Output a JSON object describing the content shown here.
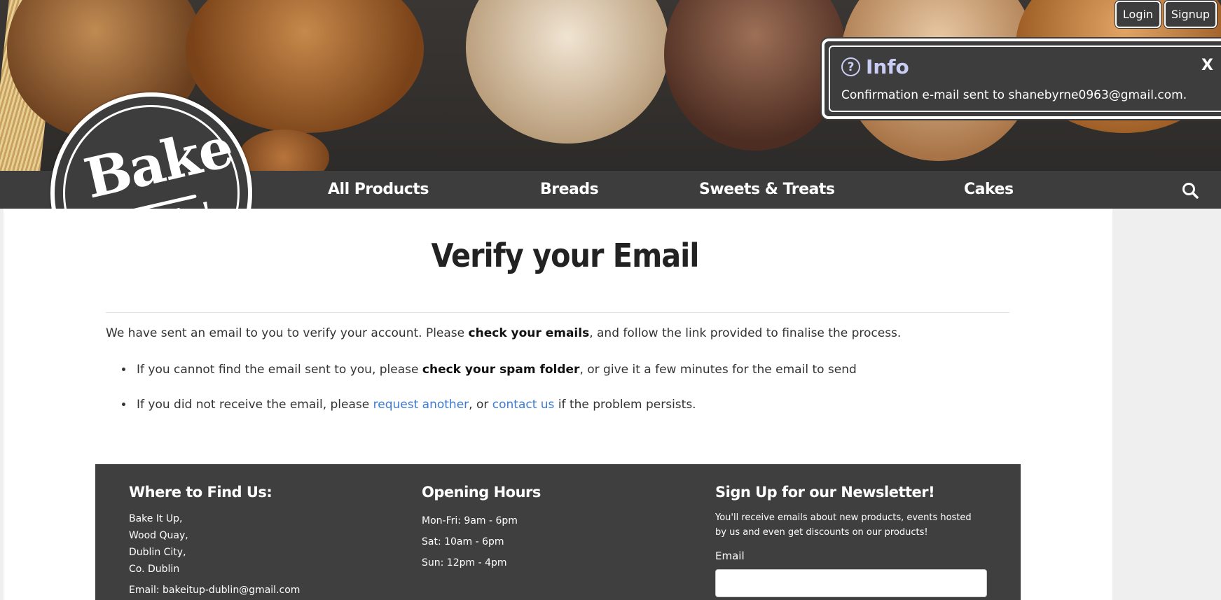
{
  "auth": {
    "login_label": "Login",
    "signup_label": "Signup"
  },
  "toast": {
    "title": "Info",
    "message": "Confirmation e-mail sent to shanebyrne0963@gmail.com.",
    "close": "X",
    "icon": "question-circle-icon",
    "title_color": "#c9cdf4"
  },
  "logo": {
    "line1": "Bake",
    "line2": "It Up!"
  },
  "nav": {
    "items": [
      "All Products",
      "Breads",
      "Sweets & Treats",
      "Cakes"
    ],
    "search_icon": "search-icon"
  },
  "page": {
    "title": "Verify your Email",
    "intro_prefix": "We have sent an email to you to verify your account. Please ",
    "intro_bold": "check your emails",
    "intro_suffix": ", and follow the link provided to finalise the process.",
    "bullet1_prefix": "If you cannot find the email sent to you, please ",
    "bullet1_bold": "check your spam folder",
    "bullet1_suffix": ", or give it a few minutes for the email to send",
    "bullet2_prefix": "If you did not receive the email, please ",
    "bullet2_link1": "request another",
    "bullet2_mid": ", or ",
    "bullet2_link2": "contact us",
    "bullet2_suffix": " if the problem persists."
  },
  "footer": {
    "find_us": {
      "heading": "Where to Find Us:",
      "lines": [
        "Bake It Up,",
        "Wood Quay,",
        "Dublin City,",
        "Co. Dublin"
      ],
      "email": "Email: bakeitup-dublin@gmail.com"
    },
    "hours": {
      "heading": "Opening Hours",
      "lines": [
        "Mon-Fri: 9am - 6pm",
        "Sat: 10am - 6pm",
        "Sun: 12pm - 4pm"
      ]
    },
    "newsletter": {
      "heading": "Sign Up for our Newsletter!",
      "text": "You'll receive emails about new products, events hosted by us and even get discounts on our products!",
      "email_label": "Email"
    }
  },
  "colors": {
    "dark": "#3d3d3d",
    "link": "#3d7bd3"
  }
}
